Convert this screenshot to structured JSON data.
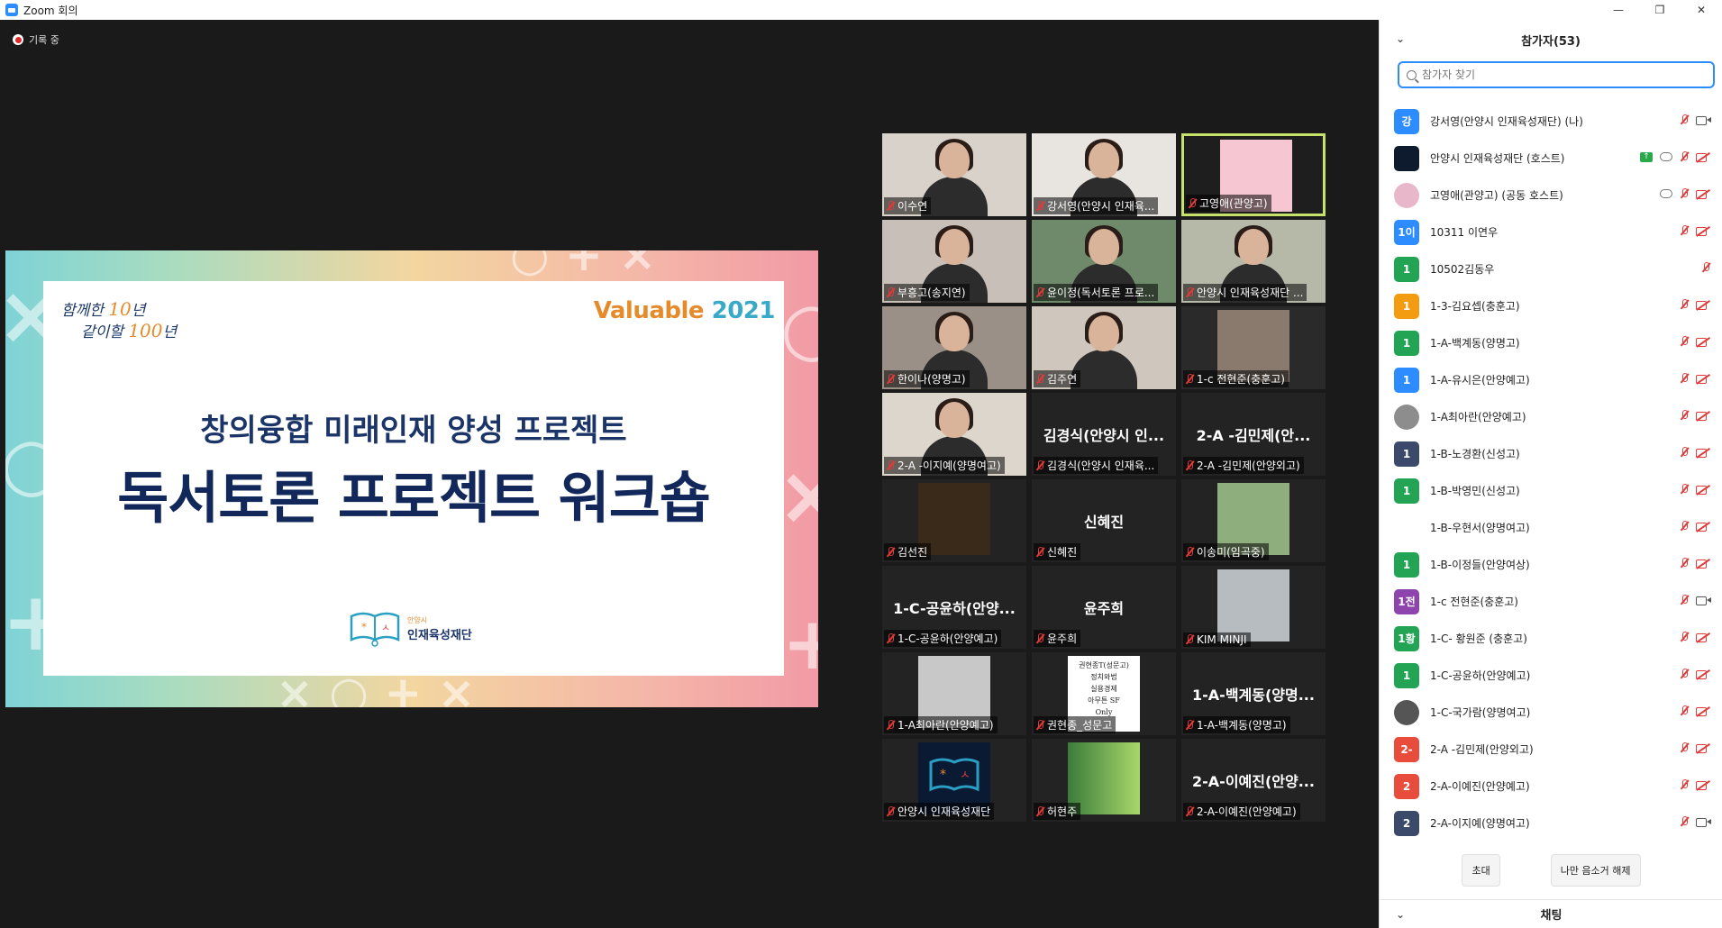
{
  "window": {
    "title": "Zoom 회의",
    "minimize": "—",
    "restore": "❐",
    "close": "✕"
  },
  "recording": {
    "label": "기록 중"
  },
  "slide": {
    "slogan_line1_a": "함께한 ",
    "slogan_num1": "10",
    "slogan_line1_b": "년",
    "slogan_line2_a": "같이할 ",
    "slogan_num2": "100",
    "slogan_line2_b": "년",
    "valuable": "Valuable",
    "year": "2021",
    "subtitle": "창의융합 미래인재 양성 프로젝트",
    "title": "독서토론 프로젝트 워크숍",
    "org_small": "안양시",
    "org_name": "인재육성재단"
  },
  "gallery": [
    {
      "label": "이수연",
      "center": ""
    },
    {
      "label": "강서영(안양시 인재육...",
      "center": ""
    },
    {
      "label": "고영애(관양고)",
      "center": ""
    },
    {
      "label": "부흥고(송지연)",
      "center": ""
    },
    {
      "label": "윤이정(독서토론 프로...",
      "center": ""
    },
    {
      "label": "안양시 인재육성재단 ...",
      "center": ""
    },
    {
      "label": "한이나(양명고)",
      "center": ""
    },
    {
      "label": "김주연",
      "center": ""
    },
    {
      "label": "1-c 전현준(충훈고)",
      "center": ""
    },
    {
      "label": "2-A -이지예(양명여고)",
      "center": ""
    },
    {
      "label": "김경식(안양시 인재육...",
      "center": "김경식(안양시 인..."
    },
    {
      "label": "2-A -김민제(안양외고)",
      "center": "2-A -김민제(안..."
    },
    {
      "label": "김선진",
      "center": ""
    },
    {
      "label": "신혜진",
      "center": "신혜진"
    },
    {
      "label": "이송미(임곡중)",
      "center": ""
    },
    {
      "label": "1-C-공윤하(안양예고)",
      "center": "1-C-공윤하(안양..."
    },
    {
      "label": "윤주희",
      "center": "윤주희"
    },
    {
      "label": "KIM MINJI",
      "center": ""
    },
    {
      "label": "1-A최아란(안양예고)",
      "center": ""
    },
    {
      "label": "권현종_성문고",
      "center": ""
    },
    {
      "label": "1-A-백계동(양명고)",
      "center": "1-A-백계동(양명..."
    },
    {
      "label": "안양시 인재육성재단",
      "center": ""
    },
    {
      "label": "허현주",
      "center": ""
    },
    {
      "label": "2-A-이예진(안양예고)",
      "center": "2-A-이예진(안양..."
    }
  ],
  "book_card": {
    "line1": "권현종T(성문고)",
    "line2": "정치와법",
    "line3": "실용경제",
    "line4": "아무튼 SF",
    "line5": "Only"
  },
  "panel": {
    "title": "참가자(53)",
    "search_placeholder": "참가자 찾기",
    "participants": [
      {
        "avatar": "강",
        "color": "#2d8cff",
        "name": "강서영(안양시 인재육성재단) (나)",
        "video": "on"
      },
      {
        "avatar": "",
        "color": "#111111",
        "name": "안양시 인재육성재단 (호스트)",
        "video": "off"
      },
      {
        "avatar": "",
        "color": "#e8b7c9",
        "name": "고영애(관양고) (공동 호스트)",
        "video": "off"
      },
      {
        "avatar": "1이",
        "color": "#2d8cff",
        "name": "10311 이연우",
        "video": "off"
      },
      {
        "avatar": "1",
        "color": "#23a455",
        "name": "10502김동우",
        "video": ""
      },
      {
        "avatar": "1",
        "color": "#f39c12",
        "name": "1-3-김요셉(충훈고)",
        "video": "off"
      },
      {
        "avatar": "1",
        "color": "#23a455",
        "name": "1-A-백계동(양명고)",
        "video": "off"
      },
      {
        "avatar": "1",
        "color": "#2d8cff",
        "name": "1-A-유시은(안양예고)",
        "video": "off"
      },
      {
        "avatar": "",
        "color": "#8d8d8d",
        "name": "1-A최아란(안양예고)",
        "video": "off"
      },
      {
        "avatar": "1",
        "color": "#3b4a6b",
        "name": "1-B-노경환(신성고)",
        "video": "off"
      },
      {
        "avatar": "1",
        "color": "#23a455",
        "name": "1-B-박영민(신성고)",
        "video": "off"
      },
      {
        "avatar": "",
        "color": "#ffffff",
        "name": "1-B-우현서(양명여고)",
        "video": "off"
      },
      {
        "avatar": "1",
        "color": "#23a455",
        "name": "1-B-이정들(안양여상)",
        "video": "off"
      },
      {
        "avatar": "1전",
        "color": "#8e44ad",
        "name": "1-c 전현준(충훈고)",
        "video": "on"
      },
      {
        "avatar": "1황",
        "color": "#23a455",
        "name": "1-C- 황원준 (충훈고)",
        "video": "off"
      },
      {
        "avatar": "1",
        "color": "#23a455",
        "name": "1-C-공윤하(안양예고)",
        "video": "off"
      },
      {
        "avatar": "",
        "color": "#555555",
        "name": "1-C-국가람(양명여고)",
        "video": "off"
      },
      {
        "avatar": "2-",
        "color": "#e74c3c",
        "name": "2-A -김민제(안양외고)",
        "video": "off"
      },
      {
        "avatar": "2",
        "color": "#e74c3c",
        "name": "2-A-이예진(안양예고)",
        "video": "off"
      },
      {
        "avatar": "2",
        "color": "#3b4a6b",
        "name": "2-A-이지예(양명여고)",
        "video": "on"
      }
    ],
    "invite_label": "초대",
    "mute_me_label": "나만 음소거 해제",
    "chat_title": "채팅"
  },
  "colors": {
    "accent": "#2d8cff",
    "active_speaker": "#c7e26a",
    "muted": "#e03b3b"
  }
}
